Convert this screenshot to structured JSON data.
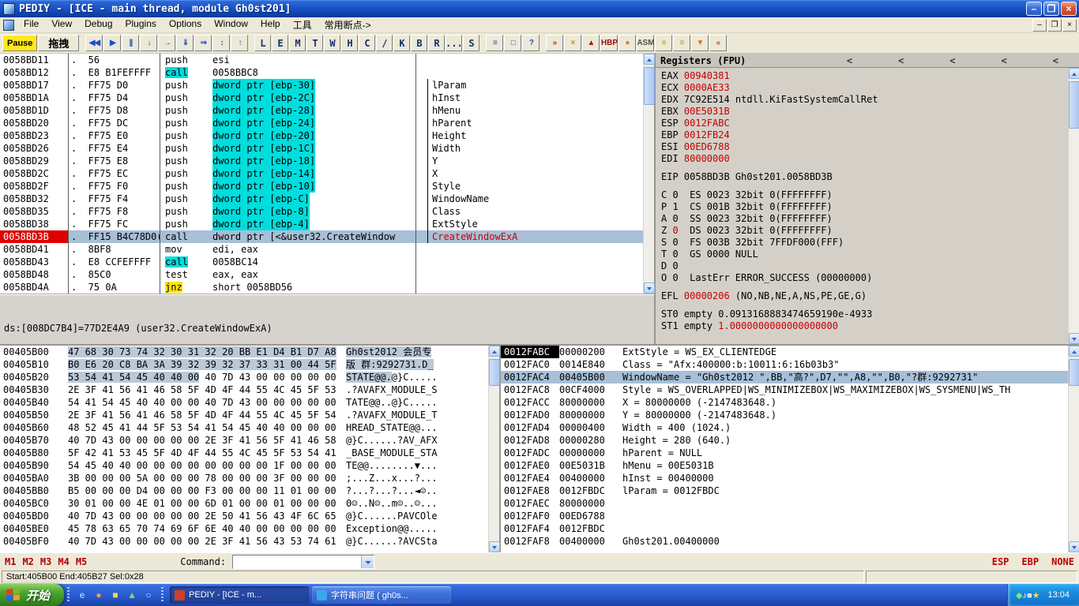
{
  "window": {
    "title": "PEDIY - [ICE - main thread, module Gh0st201]",
    "menu": [
      {
        "id": "file",
        "label": "File"
      },
      {
        "id": "view",
        "label": "View"
      },
      {
        "id": "debug",
        "label": "Debug"
      },
      {
        "id": "plugins",
        "label": "Plugins"
      },
      {
        "id": "options",
        "label": "Options"
      },
      {
        "id": "window",
        "label": "Window"
      },
      {
        "id": "help",
        "label": "Help"
      },
      {
        "id": "tools",
        "label": "工具"
      },
      {
        "id": "common-breakpoints",
        "label": "常用断点->"
      }
    ],
    "controls": [
      {
        "id": "minimize",
        "glyph": "–"
      },
      {
        "id": "restore",
        "glyph": "❐"
      },
      {
        "id": "close",
        "glyph": "×"
      }
    ],
    "mdi_controls": [
      {
        "id": "minimize",
        "glyph": "–"
      },
      {
        "id": "restore",
        "glyph": "❐"
      },
      {
        "id": "close",
        "glyph": "×"
      }
    ]
  },
  "toolbar": {
    "pause_label": "Pause",
    "drag_label": "拖拽",
    "debug_buttons": [
      {
        "id": "restart",
        "glyph": "◀◀"
      },
      {
        "id": "run",
        "glyph": "▶"
      },
      {
        "id": "pause",
        "glyph": "||"
      },
      {
        "id": "step-into",
        "glyph": "↓"
      },
      {
        "id": "step-over",
        "glyph": "→"
      },
      {
        "id": "animate-into",
        "glyph": "⇓"
      },
      {
        "id": "animate-over",
        "glyph": "⇒"
      },
      {
        "id": "trace",
        "glyph": "↕"
      },
      {
        "id": "execute-till-return",
        "glyph": "↑"
      }
    ],
    "panel_buttons": [
      {
        "id": "log",
        "label": "L"
      },
      {
        "id": "executables",
        "label": "E"
      },
      {
        "id": "memory",
        "label": "M"
      },
      {
        "id": "threads",
        "label": "T"
      },
      {
        "id": "windows",
        "label": "W"
      },
      {
        "id": "handles",
        "label": "H"
      },
      {
        "id": "cpu",
        "label": "C"
      },
      {
        "id": "patches",
        "label": "/"
      },
      {
        "id": "call-stack",
        "label": "K"
      },
      {
        "id": "breakpoints",
        "label": "B"
      },
      {
        "id": "references",
        "label": "R"
      },
      {
        "id": "run-trace",
        "label": "..."
      },
      {
        "id": "source",
        "label": "S"
      }
    ],
    "view_buttons": [
      {
        "id": "log-window",
        "glyph": "≡"
      },
      {
        "id": "windows-list",
        "glyph": "□"
      },
      {
        "id": "help",
        "glyph": "?"
      }
    ],
    "plugin_buttons": [
      {
        "id": "plugin-fly",
        "glyph": "»",
        "color": "#c83010"
      },
      {
        "id": "plugin-cut",
        "glyph": "×",
        "color": "#b89018"
      },
      {
        "id": "plugin-up",
        "glyph": "▲",
        "color": "#b01818"
      },
      {
        "id": "plugin-hbp",
        "glyph": "HBP",
        "color": "#a01010"
      },
      {
        "id": "plugin-orb",
        "glyph": "●",
        "color": "#e07818"
      },
      {
        "id": "plugin-asm",
        "glyph": "ASM",
        "color": "#505050"
      },
      {
        "id": "plugin-db1",
        "glyph": "≡",
        "color": "#c89010"
      },
      {
        "id": "plugin-db2",
        "glyph": "≡",
        "color": "#c89010"
      },
      {
        "id": "plugin-box1",
        "glyph": "▼",
        "color": "#d07818"
      },
      {
        "id": "plugin-box2",
        "glyph": "«",
        "color": "#d04818"
      }
    ]
  },
  "disasm": {
    "info_line": "ds:[008DC7B4]=77D2E4A9 (user32.CreateWindowExA)",
    "rows": [
      {
        "a": "0058BD11",
        "b": ".  56",
        "m": "push",
        "o": "esi",
        "c": ""
      },
      {
        "a": "0058BD12",
        "b": ".  E8 B1FEFFFF",
        "m": "call",
        "o": "0058BBC8",
        "ms": "hl",
        "c": ""
      },
      {
        "a": "0058BD17",
        "b": ".  FF75 D0",
        "m": "push",
        "o": "dword ptr [ebp-30]",
        "os": "hl",
        "c": "lParam",
        "cb": true
      },
      {
        "a": "0058BD1A",
        "b": ".  FF75 D4",
        "m": "push",
        "o": "dword ptr [ebp-2C]",
        "os": "hl",
        "c": "hInst",
        "cb": true
      },
      {
        "a": "0058BD1D",
        "b": ".  FF75 D8",
        "m": "push",
        "o": "dword ptr [ebp-28]",
        "os": "hl",
        "c": "hMenu",
        "cb": true
      },
      {
        "a": "0058BD20",
        "b": ".  FF75 DC",
        "m": "push",
        "o": "dword ptr [ebp-24]",
        "os": "hl",
        "c": "hParent",
        "cb": true
      },
      {
        "a": "0058BD23",
        "b": ".  FF75 E0",
        "m": "push",
        "o": "dword ptr [ebp-20]",
        "os": "hl",
        "c": "Height",
        "cb": true
      },
      {
        "a": "0058BD26",
        "b": ".  FF75 E4",
        "m": "push",
        "o": "dword ptr [ebp-1C]",
        "os": "hl",
        "c": "Width",
        "cb": true
      },
      {
        "a": "0058BD29",
        "b": ".  FF75 E8",
        "m": "push",
        "o": "dword ptr [ebp-18]",
        "os": "hl",
        "c": "Y",
        "cb": true
      },
      {
        "a": "0058BD2C",
        "b": ".  FF75 EC",
        "m": "push",
        "o": "dword ptr [ebp-14]",
        "os": "hl",
        "c": "X",
        "cb": true
      },
      {
        "a": "0058BD2F",
        "b": ".  FF75 F0",
        "m": "push",
        "o": "dword ptr [ebp-10]",
        "os": "hl",
        "c": "Style",
        "cb": true
      },
      {
        "a": "0058BD32",
        "b": ".  FF75 F4",
        "m": "push",
        "o": "dword ptr [ebp-C]",
        "os": "hl",
        "c": "WindowName",
        "cb": true
      },
      {
        "a": "0058BD35",
        "b": ".  FF75 F8",
        "m": "push",
        "o": "dword ptr [ebp-8]",
        "os": "hl",
        "c": "Class",
        "cb": true
      },
      {
        "a": "0058BD38",
        "b": ".  FF75 FC",
        "m": "push",
        "o": "dword ptr [ebp-4]",
        "os": "hl",
        "c": "ExtStyle",
        "cb": true
      },
      {
        "a": "0058BD3B",
        "b": ".  FF15 B4C78D0(",
        "m": "call",
        "o": "dword ptr [<&user32.CreateWindow",
        "c": "CreateWindowExA",
        "sel": true,
        "bp": true,
        "cr": true,
        "cb": true
      },
      {
        "a": "0058BD41",
        "b": ".  8BF8",
        "m": "mov",
        "o": "edi, eax",
        "c": ""
      },
      {
        "a": "0058BD43",
        "b": ".  E8 CCFEFFFF",
        "m": "call",
        "o": "0058BC14",
        "ms": "hl",
        "c": ""
      },
      {
        "a": "0058BD48",
        "b": ".  85C0",
        "m": "test",
        "o": "eax, eax",
        "c": ""
      },
      {
        "a": "0058BD4A",
        "b": ".  75 0A",
        "m": "jnz",
        "o": "short 0058BD56",
        "ms": "yl",
        "c": ""
      }
    ]
  },
  "registers": {
    "header": "Registers (FPU)",
    "pane_arrows": [
      "<",
      "<",
      "<",
      "<",
      "<"
    ],
    "lines": [
      [
        [
          "EAX ",
          ""
        ],
        [
          "00940381",
          "r"
        ]
      ],
      [
        [
          "ECX ",
          ""
        ],
        [
          "0000AE33",
          "r"
        ]
      ],
      [
        [
          "EDX ",
          ""
        ],
        [
          "7C92E514",
          ""
        ],
        [
          " ntdll.KiFastSystemCallRet",
          ""
        ]
      ],
      [
        [
          "EBX ",
          ""
        ],
        [
          "00E5031B",
          "r"
        ]
      ],
      [
        [
          "ESP ",
          ""
        ],
        [
          "0012FABC",
          "r"
        ]
      ],
      [
        [
          "EBP ",
          ""
        ],
        [
          "0012FB24",
          "r"
        ]
      ],
      [
        [
          "ESI ",
          ""
        ],
        [
          "00ED6788",
          "r"
        ]
      ],
      [
        [
          "EDI ",
          ""
        ],
        [
          "80000000",
          "r"
        ]
      ],
      [],
      [
        [
          "EIP ",
          ""
        ],
        [
          "0058BD3B",
          ""
        ],
        [
          " Gh0st201.0058BD3B",
          ""
        ]
      ],
      [],
      [
        [
          "C 0  ES 0023 32bit 0(FFFFFFFF)",
          ""
        ]
      ],
      [
        [
          "P 1  CS 001B 32bit 0(FFFFFFFF)",
          ""
        ]
      ],
      [
        [
          "A 0  SS 0023 32bit 0(FFFFFFFF)",
          ""
        ]
      ],
      [
        [
          "Z ",
          ""
        ],
        [
          "0",
          "r"
        ],
        [
          "  DS 0023 32bit 0(FFFFFFFF)",
          ""
        ]
      ],
      [
        [
          "S 0  FS 003B 32bit 7FFDF000(FFF)",
          ""
        ]
      ],
      [
        [
          "T 0  GS 0000 NULL",
          ""
        ]
      ],
      [
        [
          "D 0",
          ""
        ]
      ],
      [
        [
          "O 0  LastErr ERROR_SUCCESS (00000000)",
          ""
        ]
      ],
      [],
      [
        [
          "EFL ",
          ""
        ],
        [
          "00000206",
          "r"
        ],
        [
          " (NO,NB,NE,A,NS,PE,GE,G)",
          ""
        ]
      ],
      [],
      [
        [
          "ST0 empty 0.0913168883474659190e-4933",
          ""
        ]
      ],
      [
        [
          "ST1 empty ",
          ""
        ],
        [
          "1.0000000000000000000",
          "r"
        ]
      ]
    ]
  },
  "dump": {
    "rows": [
      {
        "a": "00405B00",
        "hs": "47 68 30 73 74 32 30 31 32 20 BB E1 D4 B1 D7 A8",
        "hn": "",
        "ss": "Gh0st2012 会员专",
        "sn": ""
      },
      {
        "a": "00405B10",
        "hs": "B0 E6 20 C8 BA 3A 39 32 39 32 37 33 31 00 44 5F",
        "hn": "",
        "ss": "版 群:9292731.D_",
        "sn": ""
      },
      {
        "a": "00405B20",
        "hs": "53 54 41 54 45 40 40 00",
        "hn": " 40 7D 43 00 00 00 00 00",
        "ss": "STATE@@.",
        "sn": "@}C....."
      },
      {
        "a": "00405B30",
        "hs": "",
        "hn": "2E 3F 41 56 41 46 58 5F 4D 4F 44 55 4C 45 5F 53",
        "ss": "",
        "sn": ".?AVAFX_MODULE_S"
      },
      {
        "a": "00405B40",
        "hs": "",
        "hn": "54 41 54 45 40 40 00 00 40 7D 43 00 00 00 00 00",
        "ss": "",
        "sn": "TATE@@..@}C....."
      },
      {
        "a": "00405B50",
        "hs": "",
        "hn": "2E 3F 41 56 41 46 58 5F 4D 4F 44 55 4C 45 5F 54",
        "ss": "",
        "sn": ".?AVAFX_MODULE_T"
      },
      {
        "a": "00405B60",
        "hs": "",
        "hn": "48 52 45 41 44 5F 53 54 41 54 45 40 40 00 00 00",
        "ss": "",
        "sn": "HREAD_STATE@@..."
      },
      {
        "a": "00405B70",
        "hs": "",
        "hn": "40 7D 43 00 00 00 00 00 2E 3F 41 56 5F 41 46 58",
        "ss": "",
        "sn": "@}C......?AV_AFX"
      },
      {
        "a": "00405B80",
        "hs": "",
        "hn": "5F 42 41 53 45 5F 4D 4F 44 55 4C 45 5F 53 54 41",
        "ss": "",
        "sn": "_BASE_MODULE_STA"
      },
      {
        "a": "00405B90",
        "hs": "",
        "hn": "54 45 40 40 00 00 00 00 00 00 00 00 1F 00 00 00",
        "ss": "",
        "sn": "TE@@........▼..."
      },
      {
        "a": "00405BA0",
        "hs": "",
        "hn": "3B 00 00 00 5A 00 00 00 78 00 00 00 3F 00 00 00",
        "ss": "",
        "sn": ";...Z...x...?..."
      },
      {
        "a": "00405BB0",
        "hs": "",
        "hn": "B5 00 00 00 D4 00 00 00 F3 00 00 00 11 01 00 00",
        "ss": "",
        "sn": "?...?...?...◄☺.."
      },
      {
        "a": "00405BC0",
        "hs": "",
        "hn": "30 01 00 00 4E 01 00 00 6D 01 00 00 01 00 00 00",
        "ss": "",
        "sn": "0☺..N☺..m☺..☺..."
      },
      {
        "a": "00405BD0",
        "hs": "",
        "hn": "40 7D 43 00 00 00 00 00 2E 50 41 56 43 4F 6C 65",
        "ss": "",
        "sn": "@}C......PAVCOle"
      },
      {
        "a": "00405BE0",
        "hs": "",
        "hn": "45 78 63 65 70 74 69 6F 6E 40 40 00 00 00 00 00",
        "ss": "",
        "sn": "Exception@@....."
      },
      {
        "a": "00405BF0",
        "hs": "",
        "hn": "40 7D 43 00 00 00 00 00 2E 3F 41 56 43 53 74 61",
        "ss": "",
        "sn": "@}C......?AVCSta"
      }
    ]
  },
  "stack": {
    "rows": [
      {
        "a": "0012FABC",
        "v": "00000200",
        "c": "ExtStyle = WS_EX_CLIENTEDGE",
        "esp": true
      },
      {
        "a": "0012FAC0",
        "v": "0014E840",
        "c": "Class = \"Afx:400000:b:10011:6:16b03b3\""
      },
      {
        "a": "0012FAC4",
        "v": "00405B00",
        "c": "WindowName = \"Gh0st2012 \",BB,\"高?\",D7,\"\",A8,\"\",B0,\"?群:9292731\"",
        "sel": true
      },
      {
        "a": "0012FAC8",
        "v": "00CF4000",
        "c": "Style = WS_OVERLAPPED|WS_MINIMIZEBOX|WS_MAXIMIZEBOX|WS_SYSMENU|WS_TH"
      },
      {
        "a": "0012FACC",
        "v": "80000000",
        "c": "X = 80000000 (-2147483648.)"
      },
      {
        "a": "0012FAD0",
        "v": "80000000",
        "c": "Y = 80000000 (-2147483648.)"
      },
      {
        "a": "0012FAD4",
        "v": "00000400",
        "c": "Width = 400 (1024.)"
      },
      {
        "a": "0012FAD8",
        "v": "00000280",
        "c": "Height = 280 (640.)"
      },
      {
        "a": "0012FADC",
        "v": "00000000",
        "c": "hParent = NULL"
      },
      {
        "a": "0012FAE0",
        "v": "00E5031B",
        "c": "hMenu = 00E5031B"
      },
      {
        "a": "0012FAE4",
        "v": "00400000",
        "c": "hInst = 00400000"
      },
      {
        "a": "0012FAE8",
        "v": "0012FBDC",
        "c": "lParam = 0012FBDC"
      },
      {
        "a": "0012FAEC",
        "v": "80000000",
        "c": ""
      },
      {
        "a": "0012FAF0",
        "v": "00ED6788",
        "c": ""
      },
      {
        "a": "0012FAF4",
        "v": "0012FBDC",
        "c": ""
      },
      {
        "a": "0012FAF8",
        "v": "00400000",
        "c": "Gh0st201.00400000"
      }
    ]
  },
  "command_bar": {
    "tabs": [
      "M1",
      "M2",
      "M3",
      "M4",
      "M5"
    ],
    "label": "Command:",
    "input_value": "",
    "right_labels": [
      "ESP",
      "EBP",
      "NONE"
    ]
  },
  "status_bar": {
    "left": "Start:405B00 End:405B27 Sel:0x28"
  },
  "taskbar": {
    "start_label": "开始",
    "quick_launch": [
      {
        "name": "ie-icon",
        "glyph": "e",
        "color": "#9cc8ff"
      },
      {
        "name": "media-player-icon",
        "glyph": "●",
        "color": "#ff9a3c"
      },
      {
        "name": "folder-icon",
        "glyph": "■",
        "color": "#ffd84a"
      },
      {
        "name": "messenger-icon",
        "glyph": "▲",
        "color": "#7ce058"
      },
      {
        "name": "qq-icon",
        "glyph": "○",
        "color": "#bfe4ff"
      }
    ],
    "tasks": [
      {
        "name": "task-pediy",
        "label": "PEDIY - [ICE - m...",
        "icon_color": "#d04028",
        "active": true
      },
      {
        "name": "task-string-question",
        "label": "字符串问题 ( gh0s...",
        "icon_color": "#38a8e8",
        "active": false
      }
    ],
    "tray_icons": [
      {
        "name": "antivirus-tray-icon",
        "glyph": "◆",
        "color": "#8ae07a"
      },
      {
        "name": "volume-tray-icon",
        "glyph": "♪",
        "color": "#ffffff"
      },
      {
        "name": "network-tray-icon",
        "glyph": "■",
        "color": "#cfe4ff"
      },
      {
        "name": "ime-tray-icon",
        "glyph": "★",
        "color": "#ffd84a"
      }
    ],
    "clock": "13:04"
  },
  "colors": {
    "hl_cyan": "#00dddd",
    "hl_yellow": "#ffe400",
    "row_selection": "#a7bfd7",
    "dump_selection": "#bac8d8",
    "breakpoint_red": "#dd0000",
    "changed_value_red": "#c80000",
    "comment_red": "#cc0000",
    "titlebar_blue": "#1a54c8",
    "taskbar_blue": "#2a5cd0",
    "start_green": "#3b8f24",
    "pane_gray": "#d4d0c8"
  }
}
